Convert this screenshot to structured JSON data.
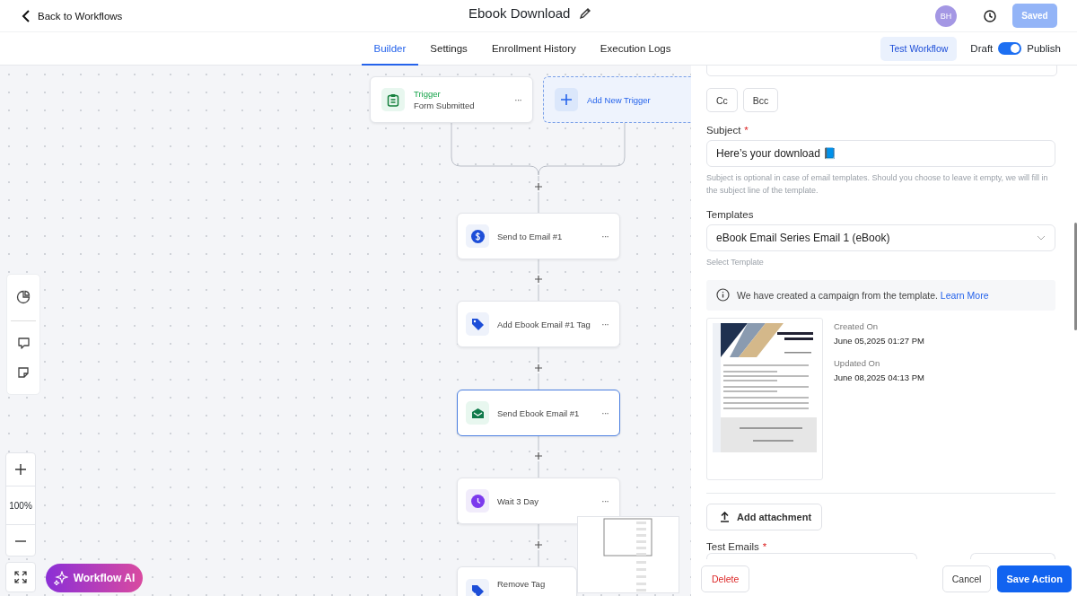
{
  "header": {
    "back_label": "Back to Workflows",
    "title": "Ebook Download",
    "avatar": "BH",
    "save_button": {
      "label": "Saved",
      "disabled": true
    }
  },
  "tabs": [
    {
      "label": "Builder",
      "selected": true
    },
    {
      "label": "Settings",
      "selected": false
    },
    {
      "label": "Enrollment History",
      "selected": false
    },
    {
      "label": "Execution Logs",
      "selected": false
    }
  ],
  "test_button": "Test Workflow",
  "publish_toggle": {
    "off_label": "Draft",
    "on_label": "Publish",
    "on": true
  },
  "canvas": {
    "trigger": {
      "title": "Trigger",
      "subtitle": "Form Submitted",
      "menu": "···"
    },
    "add_trigger": "Add New Trigger",
    "nodes": [
      {
        "label": "Send to Email #1",
        "kind": "payment",
        "selected": false,
        "menu": "···"
      },
      {
        "label": "Add Ebook Email #1 Tag",
        "kind": "tag",
        "selected": false,
        "menu": "···"
      },
      {
        "label": "Send Ebook Email #1",
        "kind": "email",
        "selected": true,
        "menu": "···"
      },
      {
        "label": "Wait 3 Day",
        "kind": "wait",
        "selected": false,
        "menu": "···"
      },
      {
        "label": "Remove Tag",
        "kind": "untag",
        "selected": false
      }
    ],
    "zoom": "100%",
    "ai_button": "Workflow AI"
  },
  "panel": {
    "cc_buttons": [
      "Cc",
      "Bcc"
    ],
    "subject": {
      "label": "Subject",
      "required_mark": "*",
      "value": "Here’s your download 📘",
      "help": "Subject is optional in case of email templates. Should you choose to leave it empty, we will fill in the subject line of the template."
    },
    "templates": {
      "label": "Templates",
      "value": "eBook Email Series Email 1 (eBook)",
      "hint": "Select Template"
    },
    "info": {
      "text": "We have created a campaign from the template.",
      "link": "Learn More"
    },
    "meta": [
      {
        "label": "Created On",
        "value": "June 05,2025 01:27 PM"
      },
      {
        "label": "Updated On",
        "value": "June 08,2025 04:13 PM"
      }
    ],
    "attachment_button": "Add attachment",
    "test_emails": {
      "label": "Test Emails",
      "required_mark": "*"
    },
    "footer": {
      "delete": "Delete",
      "cancel": "Cancel",
      "save": "Save Action"
    }
  }
}
